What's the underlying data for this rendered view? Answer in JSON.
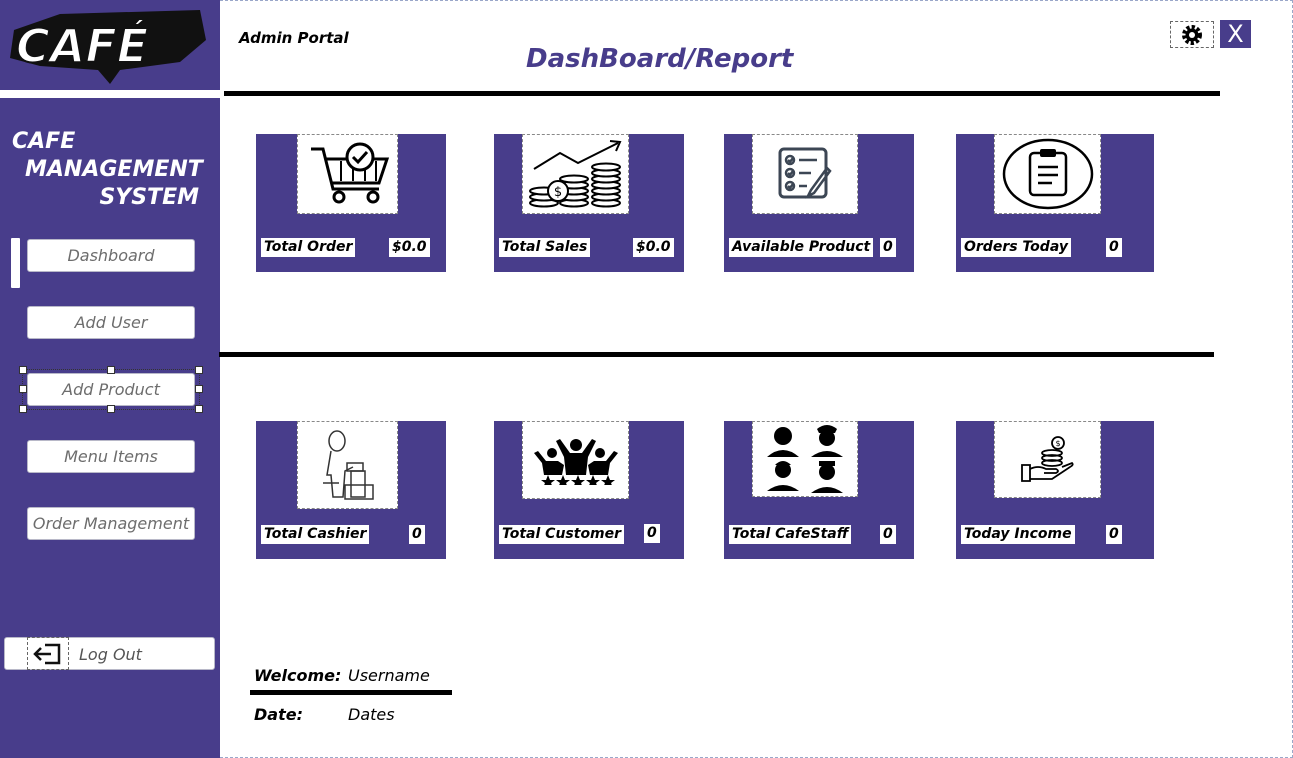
{
  "sidebar": {
    "logo_text": "CAFÉ",
    "brand_lines": [
      "CAFE",
      "MANAGEMENT",
      "SYSTEM"
    ],
    "nav": [
      {
        "label": "Dashboard"
      },
      {
        "label": "Add User"
      },
      {
        "label": "Add Product"
      },
      {
        "label": "Menu Items"
      },
      {
        "label": "Order Management"
      }
    ],
    "logout_label": "Log Out"
  },
  "header": {
    "portal_label": "Admin Portal",
    "title": "DashBoard/Report",
    "close_symbol": "X"
  },
  "cards_top": [
    {
      "label": "Total Order",
      "value": "$0.0",
      "icon": "shopping-cart-icon"
    },
    {
      "label": "Total Sales",
      "value": "$0.0",
      "icon": "sales-coins-icon"
    },
    {
      "label": "Available Product",
      "value": "0",
      "icon": "checklist-icon"
    },
    {
      "label": "Orders Today",
      "value": "0",
      "icon": "clipboard-icon"
    }
  ],
  "cards_bottom": [
    {
      "label": "Total Cashier",
      "value": "0",
      "icon": "cashier-icon"
    },
    {
      "label": "Total Customer",
      "value": "0",
      "icon": "customers-icon"
    },
    {
      "label": "Total CafeStaff",
      "value": "0",
      "icon": "staff-icon"
    },
    {
      "label": "Today Income",
      "value": "0",
      "icon": "income-hand-icon"
    }
  ],
  "footer": {
    "welcome_label": "Welcome:",
    "welcome_value": "Username",
    "date_label": "Date:",
    "date_value": "Dates"
  },
  "colors": {
    "brand": "#483d8b",
    "background": "#ffffff"
  }
}
